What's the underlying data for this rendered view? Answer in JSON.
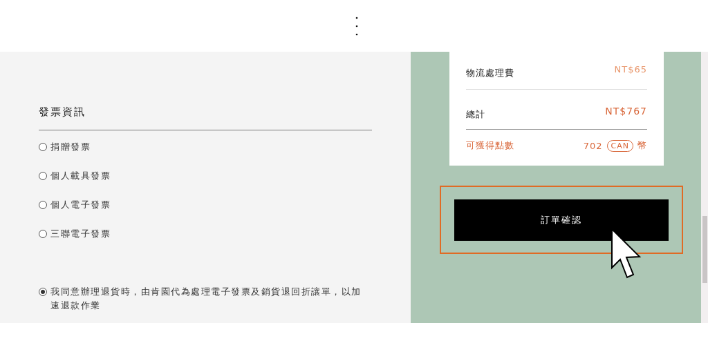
{
  "invoice": {
    "title": "發票資訊",
    "options": [
      {
        "label": "捐贈發票",
        "selected": false
      },
      {
        "label": "個人載具發票",
        "selected": false
      },
      {
        "label": "個人電子發票",
        "selected": false
      },
      {
        "label": "三聯電子發票",
        "selected": false
      }
    ],
    "agreement": {
      "label": "我同意辦理退貨時，由肯園代為處理電子發票及銷貨退回折讓單，以加速退款作業",
      "selected": true
    }
  },
  "summary": {
    "rows": [
      {
        "kind": "fee",
        "label": "物流處理費",
        "value": "NT$65"
      },
      {
        "kind": "total",
        "label": "總計",
        "value": "NT$767"
      }
    ],
    "points": {
      "label": "可獲得點數",
      "value": "702",
      "badge": "CAN",
      "unit": "幣"
    }
  },
  "confirm_button": "訂單確認"
}
